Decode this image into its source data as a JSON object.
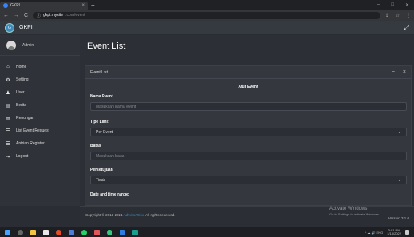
{
  "browser": {
    "tab_title": "GKPI",
    "tab_close": "×",
    "new_tab": "+",
    "win_min": "─",
    "win_max": "□",
    "win_close": "✕",
    "url_host": "gkpi.mysite",
    "url_path": ".com/event",
    "nav_back": "←",
    "nav_forward": "→",
    "reload": "C",
    "secure": "ⓘ",
    "share": "⇪",
    "star": "☆",
    "menu": "⋮"
  },
  "topnav": {
    "brand": "GKPI",
    "logo": "G",
    "expand_icon": "⤢"
  },
  "sidebar": {
    "user_name": "Admin",
    "items": [
      {
        "label": "Home",
        "icon": "⌂"
      },
      {
        "label": "Setting",
        "icon": "⚙"
      },
      {
        "label": "User",
        "icon": "♟"
      },
      {
        "label": "Berita",
        "icon": "▤"
      },
      {
        "label": "Renungan",
        "icon": "▤"
      },
      {
        "label": "List Event Request",
        "icon": "☰"
      },
      {
        "label": "Antrian Register",
        "icon": "☰"
      },
      {
        "label": "Logout",
        "icon": "⇥"
      }
    ]
  },
  "main": {
    "page_title": "Event List",
    "card_title": "Event List",
    "collapse_icon": "−",
    "close_icon": "×",
    "form_title": "Atur Event",
    "fields": {
      "nama_label": "Nama Event",
      "nama_placeholder": "Masukkan nama event",
      "tipe_label": "Tipe Limit",
      "tipe_value": "Per Event",
      "batas_label": "Batas",
      "batas_placeholder": "Masukkan batas",
      "persetujuan_label": "Persetujuan",
      "persetujuan_value": "Tidak",
      "date_label": "Date and time range:"
    },
    "select_chevron": "⌄"
  },
  "footer": {
    "copyright_prefix": "Copyright © 2014-2021 ",
    "copyright_link": "AdminLTE.io.",
    "copyright_suffix": " All rights reserved.",
    "version": "Version 3.1.0"
  },
  "windows": {
    "activate_title": "Activate Windows",
    "activate_sub": "Go to Settings to activate Windows.",
    "time": "3:01 PM",
    "date": "1/14/2022",
    "tray_icons": "^ ☁ 🔊 ENG"
  },
  "colors": {
    "accent": "#3c8dbc",
    "sidebar_bg": "#2f3238",
    "content_bg": "#2c2f35"
  }
}
